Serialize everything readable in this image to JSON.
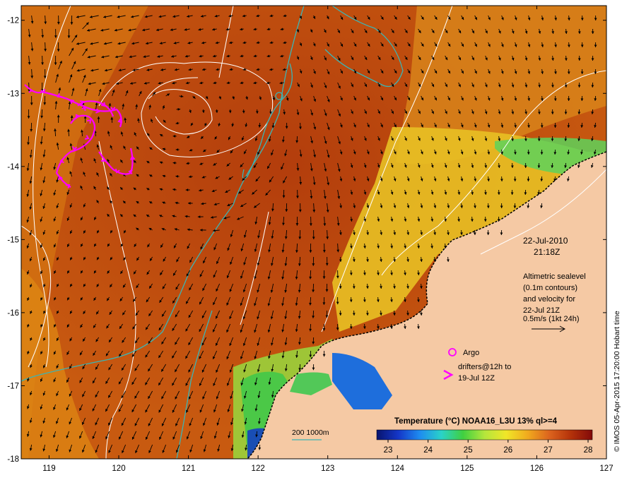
{
  "map": {
    "lon_ticks": [
      "119",
      "120",
      "121",
      "122",
      "123",
      "124",
      "125",
      "126",
      "127"
    ],
    "lat_ticks": [
      "-12",
      "-13",
      "-14",
      "-15",
      "-16",
      "-17",
      "-18"
    ],
    "lon_range": [
      118.6,
      127
    ],
    "lat_range": [
      -18,
      -11.8
    ]
  },
  "annotation": {
    "date": "22-Jul-2010",
    "time": "21:18Z",
    "altimetry_lines": [
      "Altimetric sealevel",
      "(0.1m contours)",
      "and velocity for",
      "22-Jul 21Z",
      "0.5m/s (1kt 24h)"
    ]
  },
  "legend": {
    "argo_label": "Argo",
    "drifters_line1": "drifters@12h to",
    "drifters_line2": "19-Jul 12Z",
    "depth_label": "200  1000m"
  },
  "colorbar": {
    "title": "Temperature (°C) NOAA16_L3U 13% ql>=4",
    "ticks": [
      "23",
      "24",
      "25",
      "26",
      "27",
      "28"
    ],
    "colors": [
      "#08146e",
      "#1436c8",
      "#1e8cf0",
      "#2ad2c8",
      "#40d040",
      "#b4e63c",
      "#f0e628",
      "#f0aa1e",
      "#dc641e",
      "#b4320a",
      "#820a0a"
    ]
  },
  "credit": "© IMOS 05-Apr-2015 17:20:00 Hobart time",
  "colors": {
    "land": "#f5c9a4",
    "ocean_warm": "#b9450f",
    "ocean_mid": "#d2700f",
    "isobath": "#3cb4b4",
    "drifter": "#ff00ff",
    "contour": "#ffffff"
  }
}
